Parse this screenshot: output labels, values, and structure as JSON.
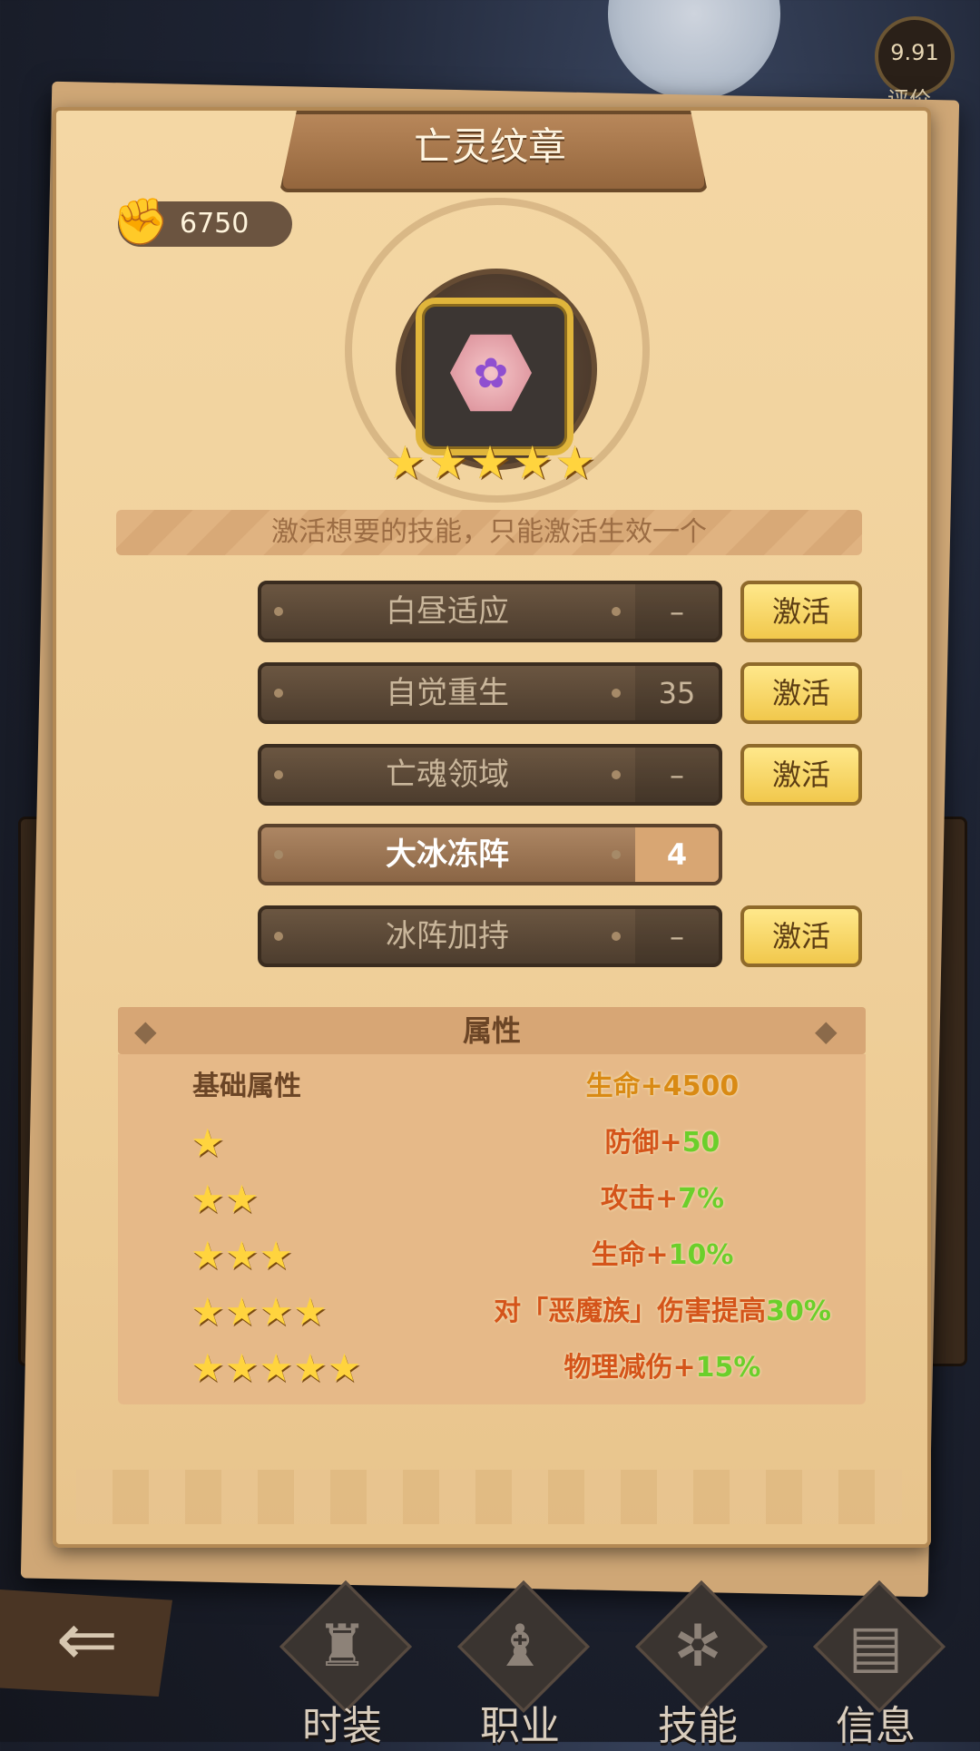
{
  "rating": {
    "score": "9.91",
    "label": "评价"
  },
  "panel": {
    "title": "亡灵纹章",
    "currency": {
      "icon": "fist-icon",
      "value": "6750"
    },
    "emblem": {
      "icon": "gem-icon",
      "stars": 5
    },
    "hint": "激活想要的技能，只能激活生效一个",
    "skills": [
      {
        "name": "白昼适应",
        "value": "–",
        "button": "激活",
        "active": false
      },
      {
        "name": "自觉重生",
        "value": "35",
        "button": "激活",
        "active": false
      },
      {
        "name": "亡魂领域",
        "value": "–",
        "button": "激活",
        "active": false
      },
      {
        "name": "大冰冻阵",
        "value": "4",
        "button": "",
        "active": true
      },
      {
        "name": "冰阵加持",
        "value": "–",
        "button": "激活",
        "active": false
      }
    ],
    "attributes": {
      "title": "属性",
      "base_label": "基础属性",
      "rows": [
        {
          "stars": 0,
          "prefix": "生命+",
          "num": "4500",
          "suffix": ""
        },
        {
          "stars": 1,
          "prefix": "防御+",
          "num": "50",
          "suffix": ""
        },
        {
          "stars": 2,
          "prefix": "攻击+",
          "num": "7%",
          "suffix": ""
        },
        {
          "stars": 3,
          "prefix": "生命+",
          "num": "10%",
          "suffix": ""
        },
        {
          "stars": 4,
          "prefix": "对「恶魔族」伤害提高",
          "num": "30%",
          "suffix": ""
        },
        {
          "stars": 5,
          "prefix": "物理减伤+",
          "num": "15%",
          "suffix": ""
        }
      ]
    }
  },
  "nav": {
    "back_icon": "back-arrow-icon",
    "items": [
      {
        "label": "时装",
        "icon": "costume-icon"
      },
      {
        "label": "职业",
        "icon": "class-icon"
      },
      {
        "label": "技能",
        "icon": "skill-icon"
      },
      {
        "label": "信息",
        "icon": "info-icon"
      }
    ]
  }
}
